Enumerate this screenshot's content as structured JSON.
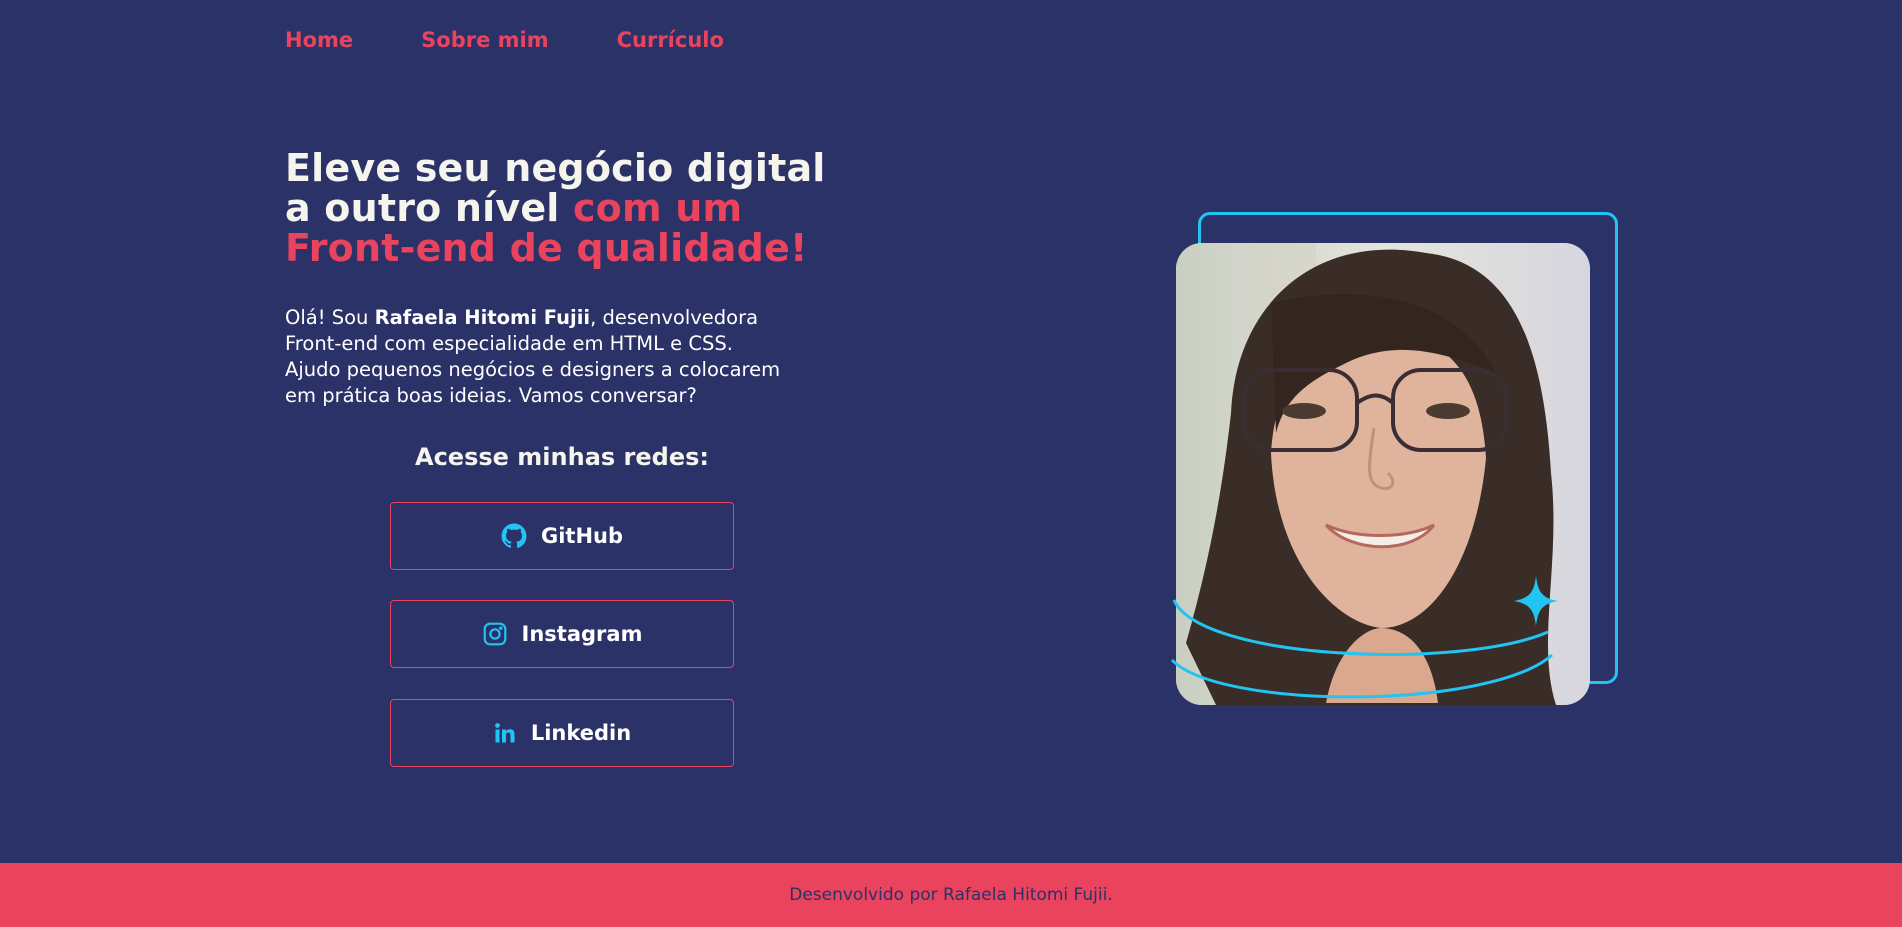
{
  "nav": {
    "items": [
      {
        "label": "Home"
      },
      {
        "label": "Sobre mim"
      },
      {
        "label": "Currículo"
      }
    ]
  },
  "hero": {
    "headline_line1": "Eleve seu negócio digital",
    "headline_line2_plain": "a outro nível ",
    "headline_line2_accent": "com um",
    "headline_line3_accent": "Front-end de qualidade!",
    "intro_prefix": "Olá! Sou ",
    "intro_name": "Rafaela Hitomi Fujii",
    "intro_line1_suffix": ", desenvolvedora",
    "intro_line2": "Front-end com especialidade em HTML e CSS.",
    "intro_line3": "Ajudo pequenos negócios e designers a colocarem",
    "intro_line4": "em prática boas ideias. Vamos conversar?"
  },
  "social": {
    "title": "Acesse minhas redes:",
    "buttons": [
      {
        "label": "GitHub",
        "icon": "github-icon"
      },
      {
        "label": "Instagram",
        "icon": "instagram-icon"
      },
      {
        "label": "Linkedin",
        "icon": "linkedin-icon"
      }
    ]
  },
  "footer": {
    "text": "Desenvolvido por Rafaela Hitomi Fujii."
  },
  "colors": {
    "background": "#2B3268",
    "accent": "#E9435E",
    "highlight": "#22C4F2",
    "text": "#F5F5EE"
  }
}
